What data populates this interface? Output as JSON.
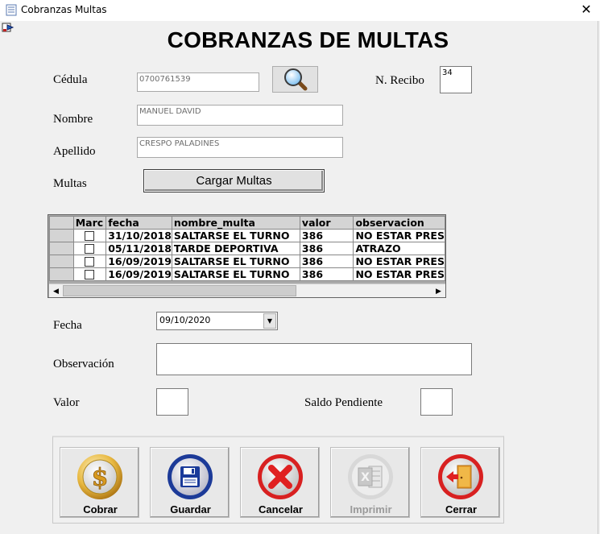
{
  "window": {
    "title": "Cobranzas  Multas",
    "close_glyph": "✕"
  },
  "heading": "COBRANZAS DE MULTAS",
  "form": {
    "cedula": {
      "label": "Cédula",
      "value": "0700761539"
    },
    "recibo": {
      "label": "N. Recibo",
      "value": "34"
    },
    "nombre": {
      "label": "Nombre",
      "value": "MANUEL DAVID"
    },
    "apellido": {
      "label": "Apellido",
      "value": "CRESPO PALADINES"
    },
    "multas": {
      "label": "Multas",
      "button_label": "Cargar Multas"
    },
    "fecha": {
      "label": "Fecha",
      "value": "09/10/2020"
    },
    "observacion": {
      "label": "Observación",
      "value": ""
    },
    "valor": {
      "label": "Valor",
      "value": ""
    },
    "saldo": {
      "label": "Saldo Pendiente",
      "value": ""
    }
  },
  "grid": {
    "columns": [
      "Marc",
      "fecha",
      "nombre_multa",
      "valor",
      "observacion"
    ],
    "rows": [
      {
        "marcado": false,
        "fecha": "31/10/2018",
        "nombre_multa": "SALTARSE EL TURNO",
        "valor": "386",
        "observacion": "NO ESTAR PRES"
      },
      {
        "marcado": false,
        "fecha": "05/11/2018",
        "nombre_multa": "TARDE DEPORTIVA",
        "valor": "386",
        "observacion": "ATRAZO"
      },
      {
        "marcado": false,
        "fecha": "16/09/2019",
        "nombre_multa": "SALTARSE EL TURNO",
        "valor": "386",
        "observacion": "NO ESTAR PRES"
      },
      {
        "marcado": false,
        "fecha": "16/09/2019",
        "nombre_multa": "SALTARSE EL TURNO",
        "valor": "386",
        "observacion": "NO ESTAR PRES"
      }
    ]
  },
  "buttons": [
    {
      "key": "cobrar",
      "label": "Cobrar",
      "icon": "dollar-coin-icon",
      "enabled": true
    },
    {
      "key": "guardar",
      "label": "Guardar",
      "icon": "floppy-disk-icon",
      "enabled": true
    },
    {
      "key": "cancelar",
      "label": "Cancelar",
      "icon": "red-x-icon",
      "enabled": true
    },
    {
      "key": "imprimir",
      "label": "Imprimir",
      "icon": "excel-icon",
      "enabled": false
    },
    {
      "key": "cerrar",
      "label": "Cerrar",
      "icon": "exit-door-icon",
      "enabled": true
    }
  ],
  "colors": {
    "accent_red": "#e02020",
    "coin_gold": "#d9a520",
    "disk_blue": "#1a3c9c",
    "exit_orange": "#e8a030"
  }
}
